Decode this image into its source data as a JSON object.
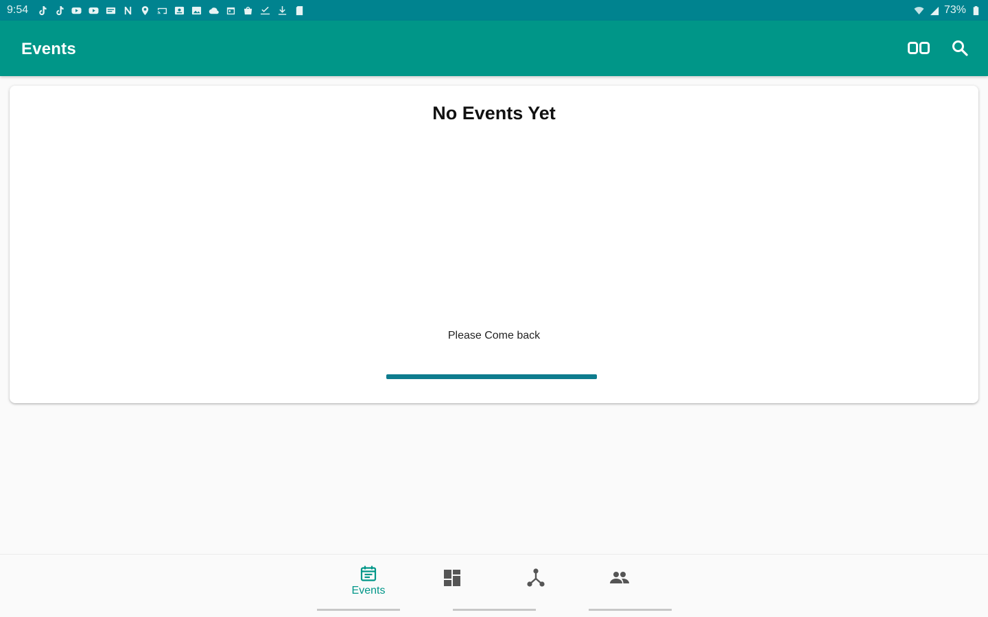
{
  "status_bar": {
    "time": "9:54",
    "battery_percent": "73%",
    "notification_icons": [
      "tiktok-icon",
      "tiktok-icon",
      "youtube-icon",
      "youtube-icon",
      "message-icon",
      "nfc-icon",
      "location-icon",
      "cast-icon",
      "photo-icon",
      "gallery-icon",
      "cloud-icon",
      "calendar-icon",
      "bag-icon",
      "check-icon",
      "download-icon",
      "sd-card-icon"
    ],
    "system_icons": [
      "wifi-icon",
      "signal-icon",
      "battery-icon"
    ]
  },
  "app_bar": {
    "title": "Events",
    "actions": [
      {
        "name": "toggle-view-icon"
      },
      {
        "name": "search-icon"
      }
    ]
  },
  "card": {
    "title": "No Events Yet",
    "subtitle": "Please Come back"
  },
  "bottom_nav": {
    "items": [
      {
        "label": "Events",
        "icon": "event-icon",
        "active": true
      },
      {
        "label": "",
        "icon": "dashboard-icon",
        "active": false
      },
      {
        "label": "",
        "icon": "network-icon",
        "active": false
      },
      {
        "label": "",
        "icon": "people-icon",
        "active": false
      }
    ]
  },
  "colors": {
    "status_bar": "#00838f",
    "app_bar": "#009688",
    "accent": "#009688",
    "card_line": "#0e7c8e",
    "background": "#fafafa"
  }
}
